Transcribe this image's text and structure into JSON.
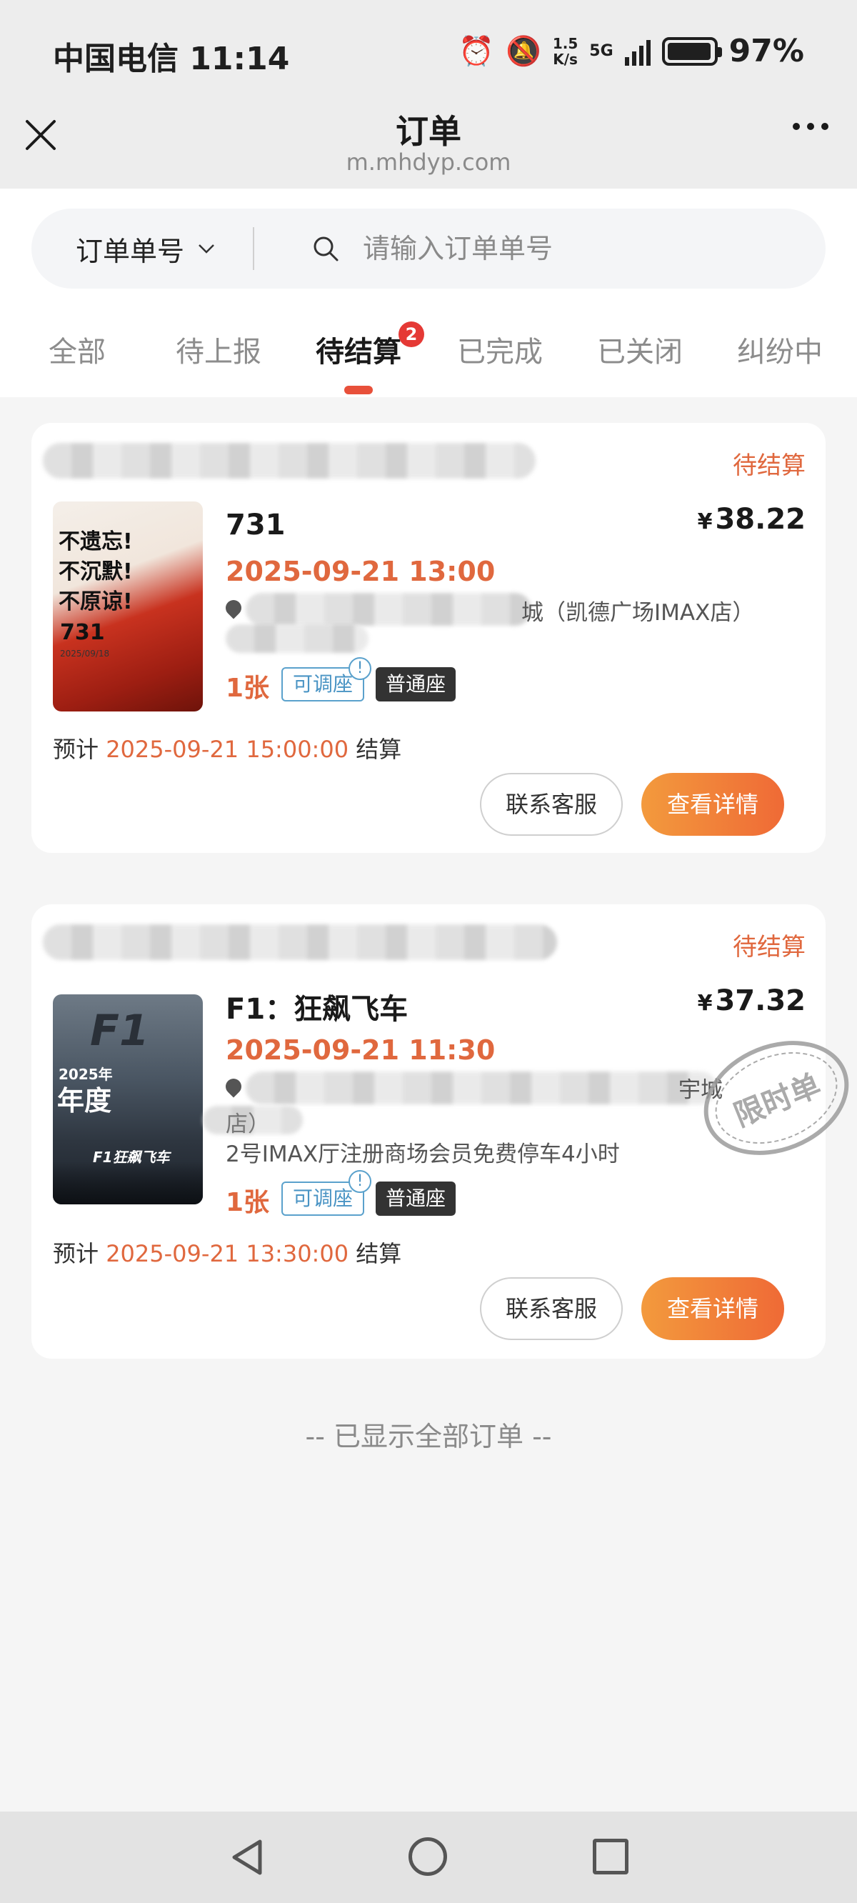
{
  "status_bar": {
    "carrier_time": "中国电信 11:14",
    "net_speed_top": "1.5",
    "net_speed_bottom": "K/s",
    "network": "5G",
    "battery_level": 0.97,
    "battery": "97%"
  },
  "nav": {
    "title": "订单",
    "url": "m.mhdyp.com"
  },
  "search": {
    "type_label": "订单单号",
    "placeholder": "请输入订单单号"
  },
  "tabs": [
    {
      "label": "全部"
    },
    {
      "label": "待上报"
    },
    {
      "label": "待结算",
      "badge": "2"
    },
    {
      "label": "已完成"
    },
    {
      "label": "已关闭"
    },
    {
      "label": "纠纷中"
    }
  ],
  "orders": [
    {
      "status": "待结算",
      "title": "731",
      "price_symbol": "¥",
      "price": "38.22",
      "showtime": "2025-09-21 13:00",
      "address_visible": "城（凯德广场IMAX店）",
      "quantity": "1张",
      "adjust_tag": "可调座",
      "seat_tag": "普通座",
      "settle_prefix": "预计",
      "settle_time": "2025-09-21 15:00:00",
      "settle_suffix": "结算",
      "service_button": "联系客服",
      "detail_button": "查看详情",
      "poster": {
        "lines": [
          "不遗忘!",
          "不沉默!",
          "不原谅!"
        ],
        "number": "731",
        "date": "2025/09/18"
      }
    },
    {
      "status": "待结算",
      "title": "F1：狂飙飞车",
      "price_symbol": "¥",
      "price": "37.32",
      "showtime": "2025-09-21 11:30",
      "address_visible": "宇城",
      "address_line2": "店）",
      "hall_info": "2号IMAX厅注册商场会员免费停车4小时",
      "quantity": "1张",
      "adjust_tag": "可调座",
      "seat_tag": "普通座",
      "settle_prefix": "预计",
      "settle_time": "2025-09-21 13:30:00",
      "settle_suffix": "结算",
      "service_button": "联系客服",
      "detail_button": "查看详情",
      "stamp": "限时单",
      "poster": {
        "logo": "F1",
        "year": "2025年",
        "big": "年度",
        "subtitle": "F1狂飙飞车"
      }
    }
  ],
  "end_note": "-- 已显示全部订单 --",
  "colors": {
    "accent": "#e0683e",
    "tag_blue": "#4a94c4",
    "button_gradient_start": "#f39a3d",
    "button_gradient_end": "#ef6a36"
  }
}
